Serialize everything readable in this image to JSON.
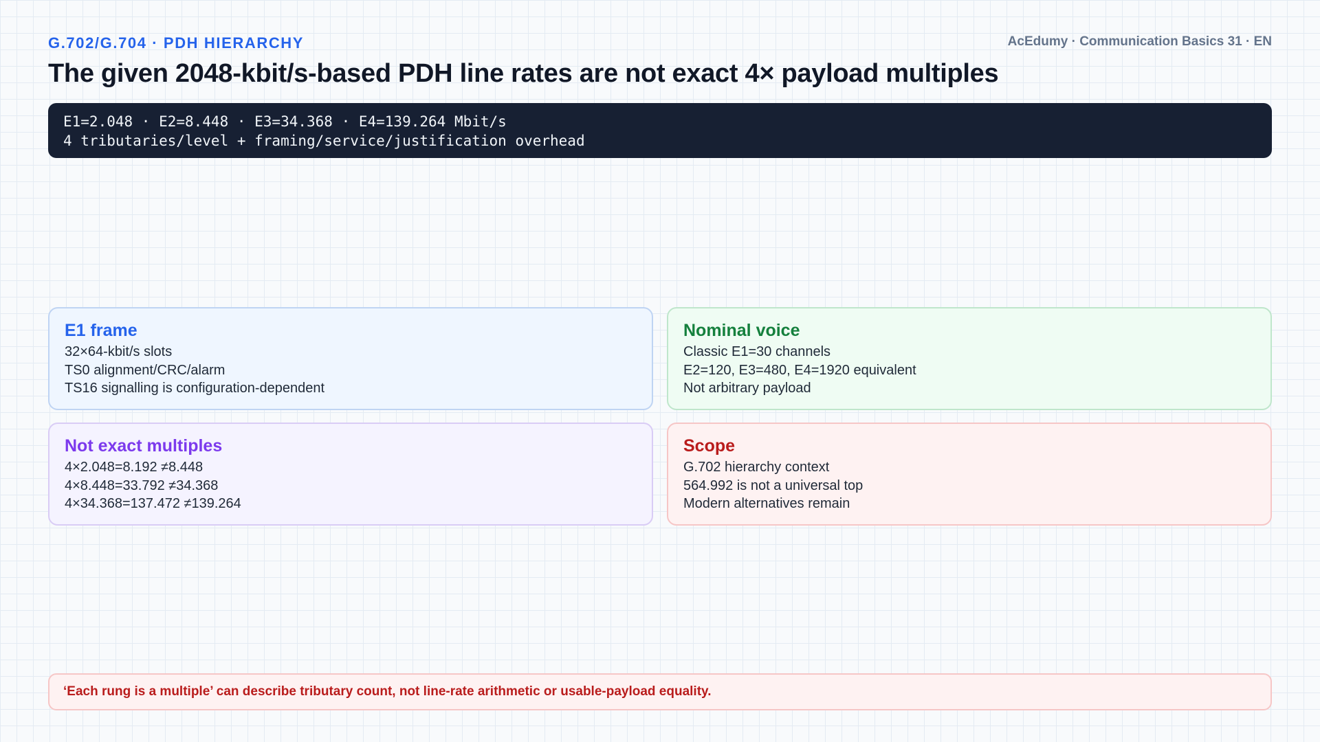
{
  "header": {
    "kicker": "G.702/G.704 · PDH HIERARCHY",
    "brand": "AcEdumy · Communication Basics 31 · EN",
    "title": "The given 2048-kbit/s-based PDH line rates are not exact 4× payload multiples"
  },
  "code_box": {
    "lines": [
      "E1=2.048 · E2=8.448 · E3=34.368 · E4=139.264 Mbit/s",
      "4 tributaries/level + framing/service/justification overhead"
    ]
  },
  "cards": [
    {
      "title": "E1 frame",
      "color": "#2563eb",
      "lines": [
        "32×64-kbit/s slots",
        "TS0 alignment/CRC/alarm",
        "TS16 signalling is configuration-dependent"
      ]
    },
    {
      "title": "Nominal voice",
      "color": "#15803d",
      "lines": [
        "Classic E1=30 channels",
        "E2=120, E3=480, E4=1920 equivalent",
        "Not arbitrary payload"
      ]
    },
    {
      "title": "Not exact multiples",
      "color": "#7c3aed",
      "lines": [
        "4×2.048=8.192 ≠8.448",
        "4×8.448=33.792 ≠34.368",
        "4×34.368=137.472 ≠139.264"
      ]
    },
    {
      "title": "Scope",
      "color": "#b91c1c",
      "lines": [
        "G.702 hierarchy context",
        "564.992 is not a universal top",
        "Modern alternatives remain"
      ]
    }
  ],
  "footer": {
    "note": "‘Each rung is a multiple’ can describe tributary count, not line-rate arithmetic or usable-payload equality."
  }
}
